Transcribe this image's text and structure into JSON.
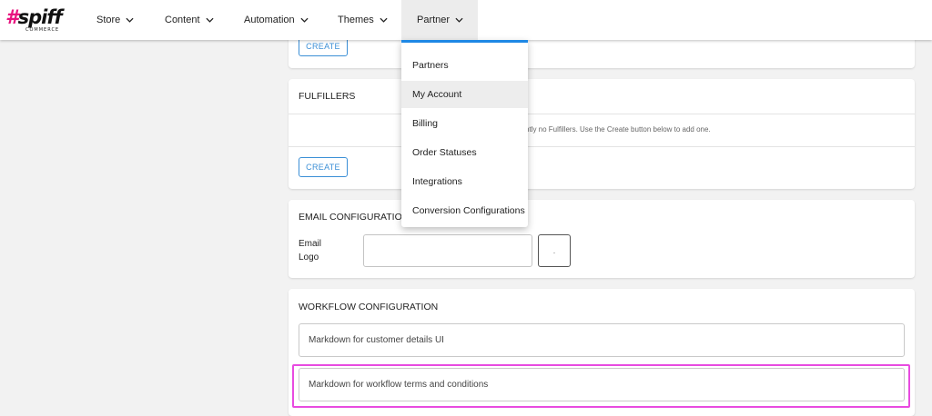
{
  "brand": {
    "logo_main": "spiff",
    "logo_hash": "#",
    "logo_sub": "COMMERCE"
  },
  "nav": {
    "items": [
      {
        "label": "Store"
      },
      {
        "label": "Content"
      },
      {
        "label": "Automation"
      },
      {
        "label": "Themes"
      },
      {
        "label": "Partner",
        "active": true
      }
    ]
  },
  "dropdown": {
    "accent_color": "#1e88e5",
    "items": [
      {
        "label": "Partners"
      },
      {
        "label": "My Account",
        "hovered": true
      },
      {
        "label": "Billing"
      },
      {
        "label": "Order Statuses"
      },
      {
        "label": "Integrations"
      },
      {
        "label": "Conversion Configurations"
      }
    ]
  },
  "top_card": {
    "create_label": "CREATE"
  },
  "fulfillers": {
    "title": "FULFILLERS",
    "empty_message": "ntly no Fulfillers. Use the Create button below to add one.",
    "create_label": "CREATE"
  },
  "email_config": {
    "title": "EMAIL CONFIGURATION",
    "logo_label_line1": "Email",
    "logo_label_line2": "Logo",
    "small_box_text": "."
  },
  "workflow_config": {
    "title": "WORKFLOW CONFIGURATION",
    "customer_details_placeholder": "Markdown for customer details UI",
    "terms_placeholder": "Markdown for workflow terms and conditions",
    "highlight_color": "#e84be0"
  }
}
